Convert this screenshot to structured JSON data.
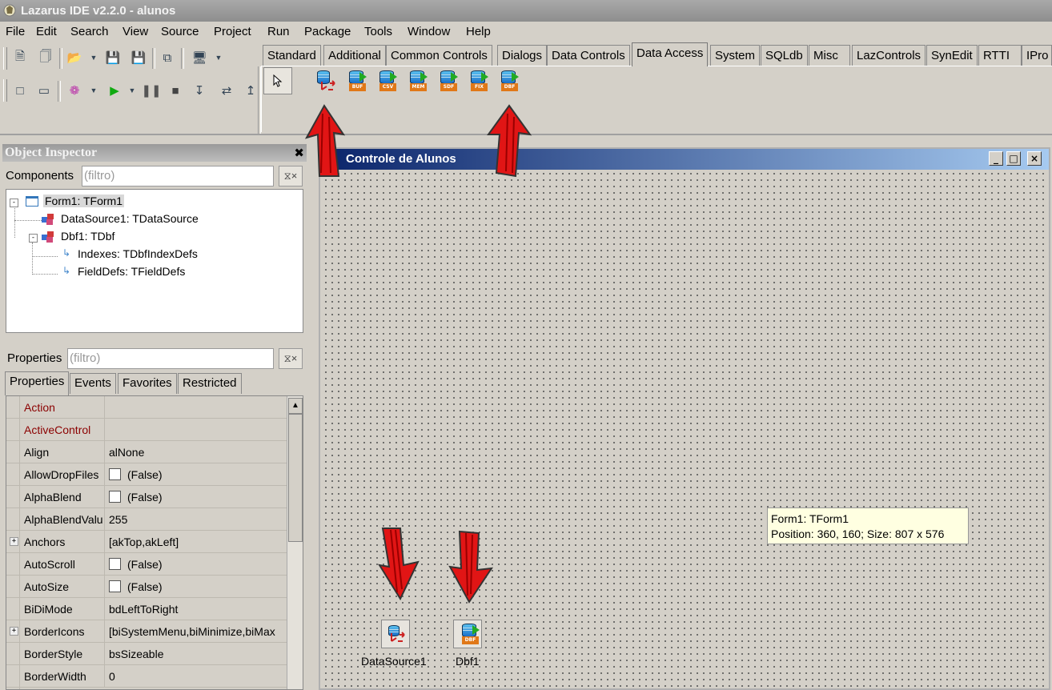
{
  "window": {
    "title": "Lazarus IDE v2.2.0 - alunos"
  },
  "menu": [
    "File",
    "Edit",
    "Search",
    "View",
    "Source",
    "Project",
    "Run",
    "Package",
    "Tools",
    "Window",
    "Help"
  ],
  "palette": {
    "tabs": [
      "Standard",
      "Additional",
      "Common Controls",
      "Dialogs",
      "Data Controls",
      "Data Access",
      "System",
      "SQLdb",
      "Misc",
      "LazControls",
      "SynEdit",
      "RTTI",
      "IPro"
    ],
    "active_tab": "Data Access",
    "components": [
      {
        "icon": "datasource-icon",
        "label": ""
      },
      {
        "icon": "buf-dataset-icon",
        "label": "BUF"
      },
      {
        "icon": "csv-dataset-icon",
        "label": "CSV"
      },
      {
        "icon": "mem-dataset-icon",
        "label": "MEM"
      },
      {
        "icon": "sdf-dataset-icon",
        "label": "SDF"
      },
      {
        "icon": "fix-dataset-icon",
        "label": "FIX"
      },
      {
        "icon": "dbf-dataset-icon",
        "label": "DBF"
      }
    ]
  },
  "object_inspector": {
    "title": "Object Inspector",
    "components_label": "Components",
    "components_filter_placeholder": "(filtro)",
    "properties_label": "Properties",
    "properties_filter_placeholder": "(filtro)",
    "tree": [
      {
        "text": "Form1: TForm1"
      },
      {
        "text": "DataSource1: TDataSource"
      },
      {
        "text": "Dbf1: TDbf"
      },
      {
        "text": "Indexes: TDbfIndexDefs"
      },
      {
        "text": "FieldDefs: TFieldDefs"
      }
    ],
    "tabs": [
      "Properties",
      "Events",
      "Favorites",
      "Restricted"
    ],
    "properties": [
      {
        "name": "Action",
        "value": "",
        "color": "#8b0000"
      },
      {
        "name": "ActiveControl",
        "value": "",
        "color": "#8b0000"
      },
      {
        "name": "Align",
        "value": "alNone"
      },
      {
        "name": "AllowDropFiles",
        "value": "(False)",
        "checkbox": true
      },
      {
        "name": "AlphaBlend",
        "value": "(False)",
        "checkbox": true
      },
      {
        "name": "AlphaBlendValu",
        "value": "255"
      },
      {
        "name": "Anchors",
        "value": "[akTop,akLeft]",
        "expandable": true
      },
      {
        "name": "AutoScroll",
        "value": "(False)",
        "checkbox": true
      },
      {
        "name": "AutoSize",
        "value": "(False)",
        "checkbox": true
      },
      {
        "name": "BiDiMode",
        "value": "bdLeftToRight"
      },
      {
        "name": "BorderIcons",
        "value": "[biSystemMenu,biMinimize,biMax",
        "expandable": true
      },
      {
        "name": "BorderStyle",
        "value": "bsSizeable"
      },
      {
        "name": "BorderWidth",
        "value": "0"
      }
    ]
  },
  "form": {
    "title": "Controle de Alunos",
    "buttons": {
      "minimize": "_",
      "maximize": "□",
      "close": "×"
    },
    "components": [
      {
        "label": "DataSource1"
      },
      {
        "label": "Dbf1",
        "badge": "DBF"
      }
    ],
    "hint": {
      "line1": "Form1: TForm1",
      "line2": "Position: 360, 160; Size: 807 x 576"
    }
  },
  "colors": {
    "annotation_arrow": "#e11515",
    "form_caption": "#0a246a"
  }
}
